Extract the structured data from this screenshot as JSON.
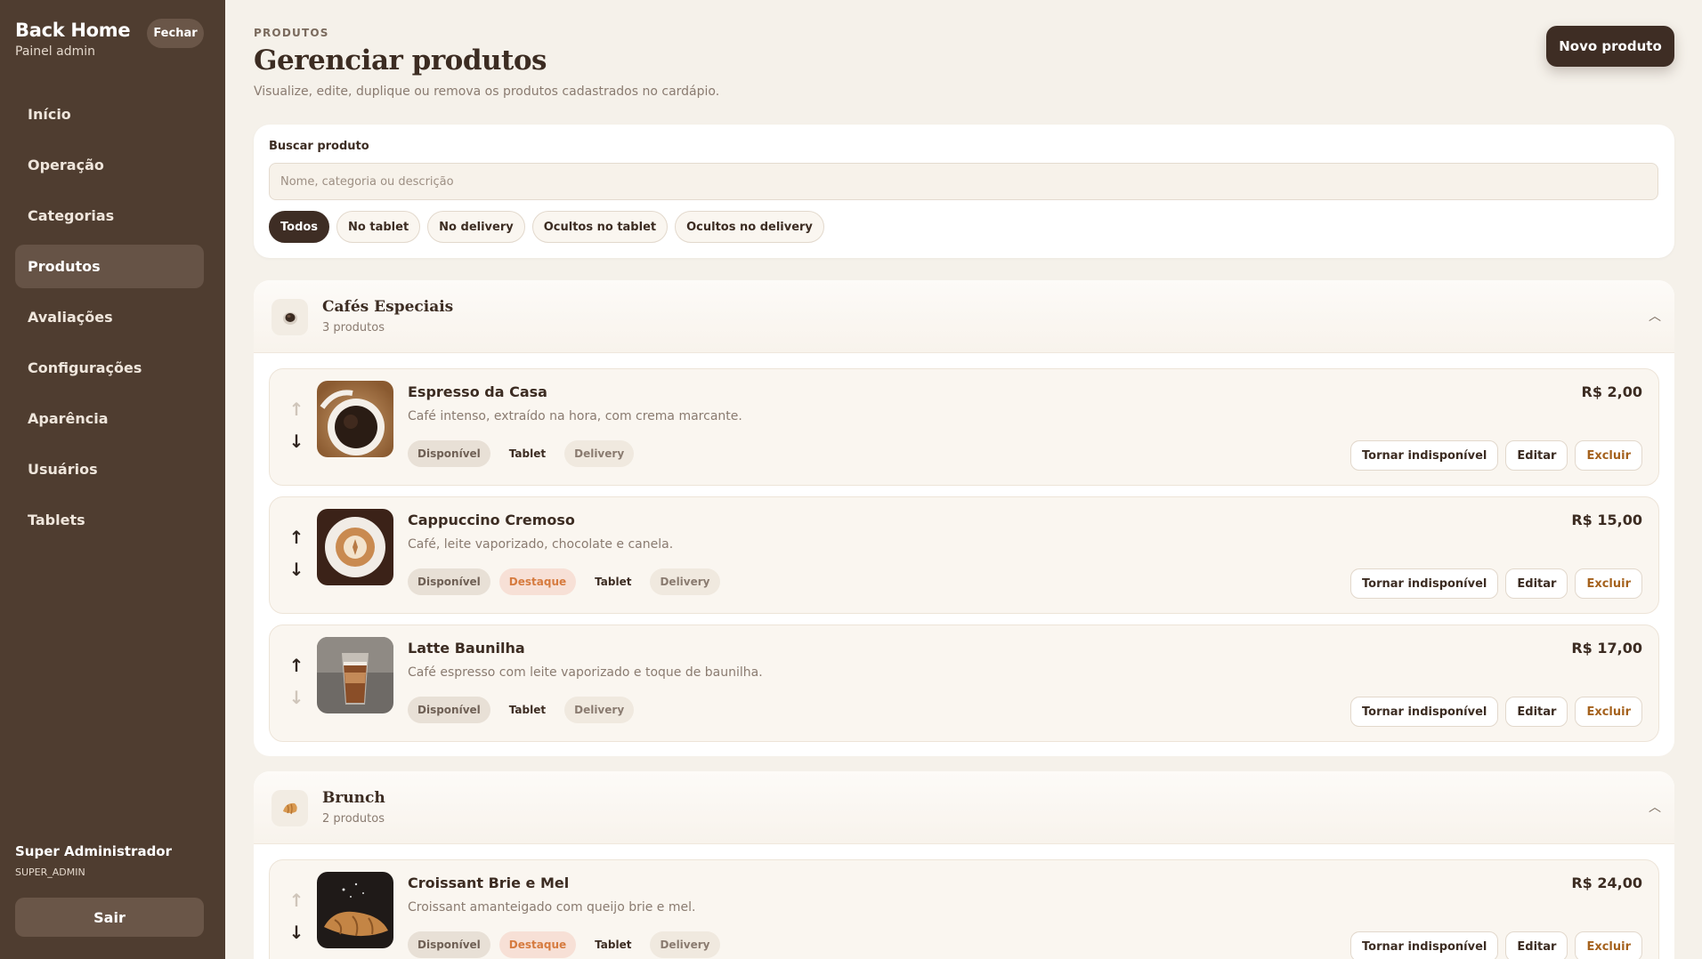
{
  "sidebar": {
    "brand_title": "Back Home",
    "brand_sub": "Painel admin",
    "close_label": "Fechar",
    "items": [
      {
        "label": "Início"
      },
      {
        "label": "Operação"
      },
      {
        "label": "Categorias"
      },
      {
        "label": "Produtos"
      },
      {
        "label": "Avaliações"
      },
      {
        "label": "Configurações"
      },
      {
        "label": "Aparência"
      },
      {
        "label": "Usuários"
      },
      {
        "label": "Tablets"
      }
    ],
    "active_item": "Produtos",
    "user_name": "Super Administrador",
    "user_role": "SUPER_ADMIN",
    "logout_label": "Sair"
  },
  "header": {
    "eyebrow": "PRODUTOS",
    "title": "Gerenciar produtos",
    "subtitle": "Visualize, edite, duplique ou remova os produtos cadastrados no cardápio.",
    "new_button": "Novo produto"
  },
  "search": {
    "label": "Buscar produto",
    "value": "",
    "placeholder": "Nome, categoria ou descrição",
    "filters": [
      "Todos",
      "No tablet",
      "No delivery",
      "Ocultos no tablet",
      "Ocultos no delivery"
    ],
    "active_filter": "Todos"
  },
  "labels": {
    "available": "Disponível",
    "featured": "Destaque",
    "tablet": "Tablet",
    "delivery": "Delivery",
    "make_unavailable": "Tornar indisponível",
    "edit": "Editar",
    "delete": "Excluir"
  },
  "categories": [
    {
      "name": "Cafés Especiais",
      "count": "3 produtos",
      "icon": "coffee-cup-icon",
      "products": [
        {
          "name": "Espresso da Casa",
          "description": "Café intenso, extraído na hora, com crema marcante.",
          "price": "R$ 2,00"
        },
        {
          "name": "Cappuccino Cremoso",
          "description": "Café, leite vaporizado, chocolate e canela.",
          "price": "R$ 15,00"
        },
        {
          "name": "Latte Baunilha",
          "description": "Café espresso com leite vaporizado e toque de baunilha.",
          "price": "R$ 17,00"
        }
      ]
    },
    {
      "name": "Brunch",
      "count": "2 produtos",
      "icon": "croissant-icon",
      "products": [
        {
          "name": "Croissant Brie e Mel",
          "description": "Croissant amanteigado com queijo brie e mel.",
          "price": "R$ 24,00"
        }
      ]
    }
  ],
  "colors": {
    "sidebar_bg": "#4f3d30",
    "accent_dark": "#3e2d24",
    "featured": "#d67b3f",
    "danger": "#a5621e",
    "page_bg": "#f5f1ea"
  }
}
